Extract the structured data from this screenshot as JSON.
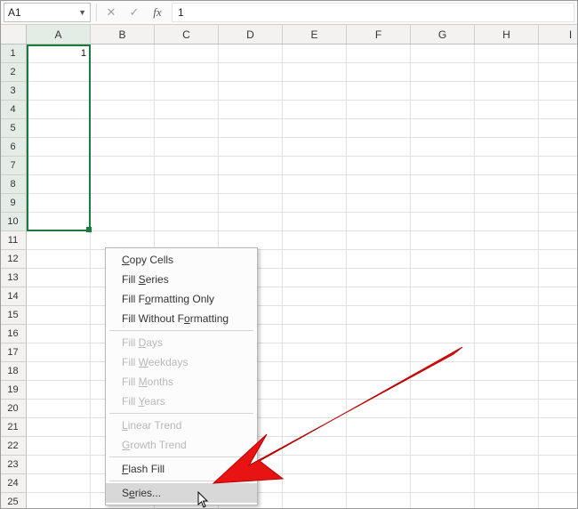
{
  "name_box": {
    "value": "A1"
  },
  "formula_bar": {
    "cancel_glyph": "✕",
    "enter_glyph": "✓",
    "fx_label": "fx",
    "value": "1"
  },
  "columns": [
    "A",
    "B",
    "C",
    "D",
    "E",
    "F",
    "G",
    "H",
    "I"
  ],
  "rows": [
    1,
    2,
    3,
    4,
    5,
    6,
    7,
    8,
    9,
    10,
    11,
    12,
    13,
    14,
    15,
    16,
    17,
    18,
    19,
    20,
    21,
    22,
    23,
    24,
    25
  ],
  "selection": {
    "start": "A1",
    "end": "A10"
  },
  "cell_A1": "1",
  "context_menu": {
    "items": [
      {
        "label_pre": "",
        "accel": "C",
        "label_post": "opy Cells",
        "enabled": true
      },
      {
        "label_pre": "Fill ",
        "accel": "S",
        "label_post": "eries",
        "enabled": true
      },
      {
        "label_pre": "Fill F",
        "accel": "o",
        "label_post": "rmatting Only",
        "enabled": true
      },
      {
        "label_pre": "Fill Without F",
        "accel": "o",
        "label_post": "rmatting",
        "enabled": true
      },
      {
        "sep": true
      },
      {
        "label_pre": "Fill ",
        "accel": "D",
        "label_post": "ays",
        "enabled": false
      },
      {
        "label_pre": "Fill ",
        "accel": "W",
        "label_post": "eekdays",
        "enabled": false
      },
      {
        "label_pre": "Fill ",
        "accel": "M",
        "label_post": "onths",
        "enabled": false
      },
      {
        "label_pre": "Fill ",
        "accel": "Y",
        "label_post": "ears",
        "enabled": false
      },
      {
        "sep": true
      },
      {
        "label_pre": "",
        "accel": "L",
        "label_post": "inear Trend",
        "enabled": false
      },
      {
        "label_pre": "",
        "accel": "G",
        "label_post": "rowth Trend",
        "enabled": false
      },
      {
        "sep": true
      },
      {
        "label_pre": "",
        "accel": "F",
        "label_post": "lash Fill",
        "enabled": true
      },
      {
        "sep": true
      },
      {
        "label_pre": "S",
        "accel": "e",
        "label_post": "ries...",
        "enabled": true,
        "hover": true
      }
    ]
  }
}
